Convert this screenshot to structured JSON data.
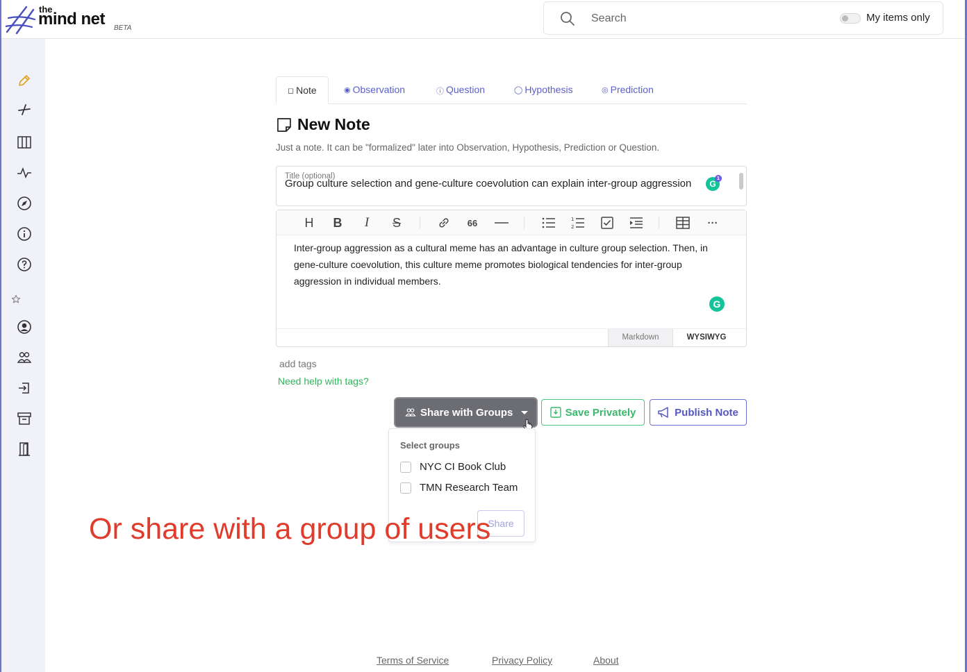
{
  "header": {
    "logo_the": "the",
    "logo_name": "mind net",
    "logo_badge": "BETA",
    "search_placeholder": "Search",
    "my_items_toggle_label": "My items only",
    "my_items_toggle_on": false
  },
  "sidebar": {
    "items": [
      {
        "icon": "pencil-icon",
        "active": true
      },
      {
        "icon": "sparkle-icon"
      },
      {
        "icon": "map-icon"
      },
      {
        "icon": "activity-icon"
      },
      {
        "icon": "compass-icon"
      },
      {
        "icon": "info-icon"
      },
      {
        "icon": "help-icon"
      },
      {
        "icon": "star-icon"
      },
      {
        "icon": "user-circle-icon"
      },
      {
        "icon": "users-icon"
      },
      {
        "icon": "login-icon"
      },
      {
        "icon": "archive-icon"
      },
      {
        "icon": "door-icon"
      }
    ]
  },
  "tabs": [
    {
      "label": "Note",
      "active": true
    },
    {
      "label": "Observation"
    },
    {
      "label": "Question"
    },
    {
      "label": "Hypothesis"
    },
    {
      "label": "Prediction"
    }
  ],
  "form": {
    "heading": "New Note",
    "subtitle": "Just a note. It can be \"formalized\" later into Observation, Hypothesis, Prediction or Question.",
    "title_label": "Title (optional)",
    "title_value": "Group culture selection and gene-culture coevolution can explain inter-group aggression",
    "body": "Inter-group aggression as a cultural meme has an advantage in culture group selection. Then, in gene-culture coevolution, this culture meme promotes biological tendencies for inter-group aggression in individual members.",
    "grammarly_letter": "G",
    "grammarly_count": "1",
    "mode_markdown": "Markdown",
    "mode_wysiwyg": "WYSIWYG",
    "tags_placeholder": "add tags",
    "tags_help": "Need help with tags?"
  },
  "toolbar": {
    "heading": "H",
    "bold": "B",
    "italic": "I",
    "strike": "S",
    "quote": "66",
    "more": "···"
  },
  "actions": {
    "share_groups": "Share with Groups",
    "save_privately": "Save Privately",
    "publish": "Publish Note"
  },
  "dropdown": {
    "heading": "Select groups",
    "groups": [
      "NYC CI Book Club",
      "TMN Research Team"
    ],
    "share_button": "Share"
  },
  "caption": "Or share with a group of users",
  "footer": {
    "terms": "Terms of Service",
    "privacy": "Privacy Policy",
    "about": "About"
  },
  "colors": {
    "accent": "#5b5fc7",
    "green": "#3cb86b",
    "caption_red": "#e03b2b",
    "sidebar_bg": "#f1f2f9"
  }
}
